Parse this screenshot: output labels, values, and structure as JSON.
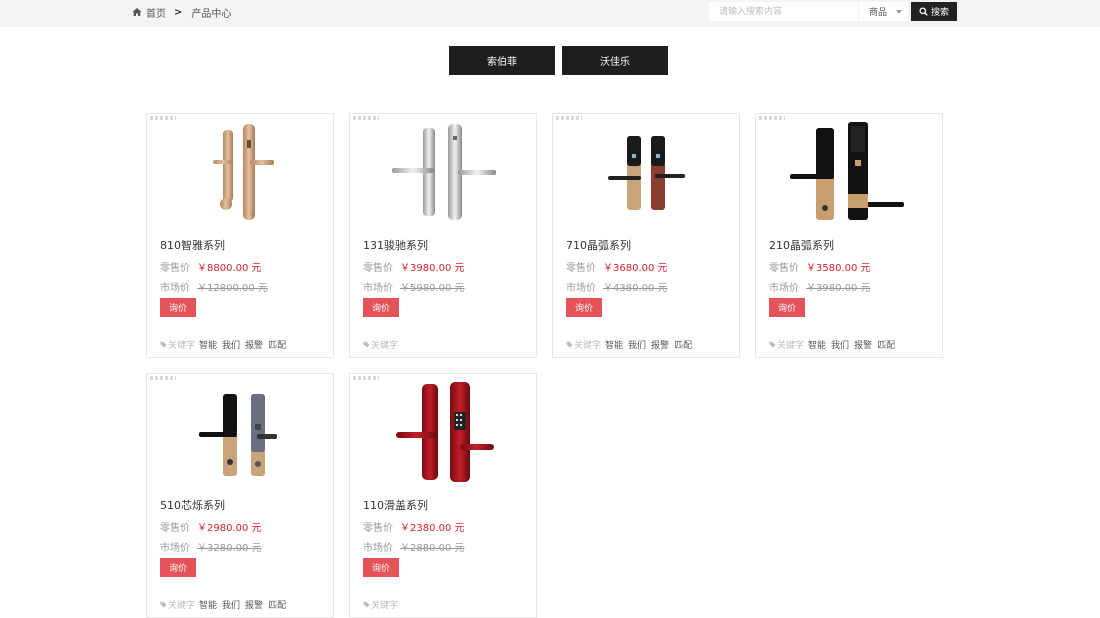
{
  "breadcrumb": {
    "home": "首页",
    "separator": ">",
    "current": "产品中心"
  },
  "search": {
    "placeholder": "请输入搜索内容",
    "category": "商品",
    "button": "搜索"
  },
  "brands": [
    "索伯菲",
    "沃佳乐"
  ],
  "labels": {
    "retail": "零售价",
    "market": "市场价",
    "inquiry": "询价",
    "keywords": "关键字"
  },
  "products": [
    {
      "name": "810智雅系列",
      "retail": "￥8800.00 元",
      "market": "￥12800.00 元",
      "tags": [
        "智能",
        "我们",
        "报警",
        "匹配"
      ]
    },
    {
      "name": "131骏驰系列",
      "retail": "￥3980.00 元",
      "market": "￥5980.00 元",
      "tags": []
    },
    {
      "name": "710晶弧系列",
      "retail": "￥3680.00 元",
      "market": "￥4380.00 元",
      "tags": [
        "智能",
        "我们",
        "报警",
        "匹配"
      ]
    },
    {
      "name": "210晶弧系列",
      "retail": "￥3580.00 元",
      "market": "￥3980.00 元",
      "tags": [
        "智能",
        "我们",
        "报警",
        "匹配"
      ]
    },
    {
      "name": "510芯烁系列",
      "retail": "￥2980.00 元",
      "market": "￥3280.00 元",
      "tags": [
        "智能",
        "我们",
        "报警",
        "匹配"
      ]
    },
    {
      "name": "110滑盖系列",
      "retail": "￥2380.00 元",
      "market": "￥2880.00 元",
      "tags": []
    }
  ],
  "colors": {
    "accent_red": "#d8232a",
    "button_red": "#e4535a",
    "dark": "#1e1e1e"
  },
  "icons": {
    "home": "home-icon",
    "search": "search-icon",
    "tag": "tag-icon",
    "caret": "chevron-down-icon"
  }
}
